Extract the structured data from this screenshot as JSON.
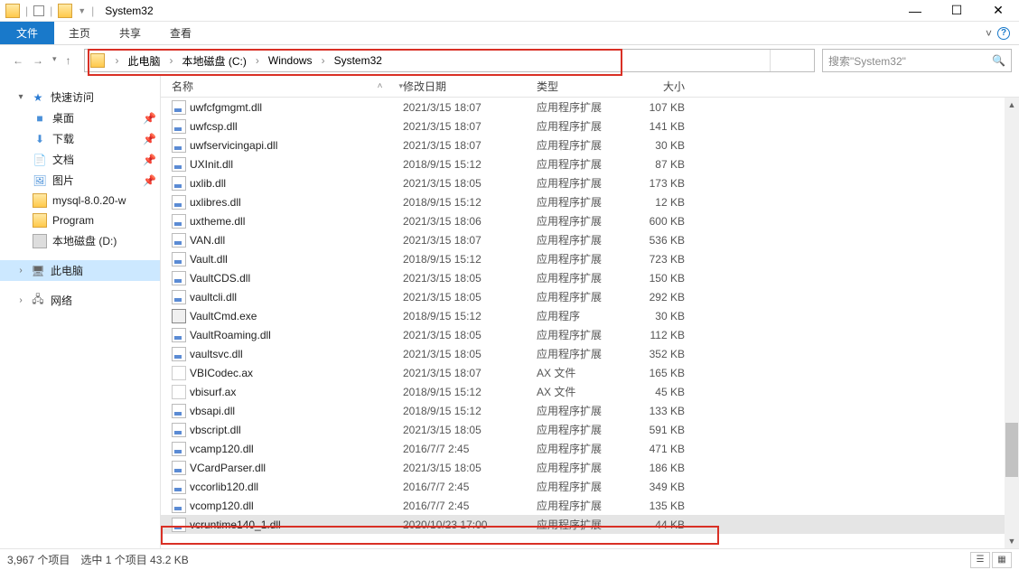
{
  "window": {
    "title": "System32"
  },
  "ribbon": {
    "file": "文件",
    "tabs": [
      "主页",
      "共享",
      "查看"
    ]
  },
  "breadcrumbs": [
    "此电脑",
    "本地磁盘 (C:)",
    "Windows",
    "System32"
  ],
  "search": {
    "placeholder": "搜索\"System32\""
  },
  "navpane": {
    "quick": {
      "label": "快速访问",
      "items": [
        {
          "label": "桌面",
          "pin": true,
          "icon": "desktop"
        },
        {
          "label": "下载",
          "pin": true,
          "icon": "download"
        },
        {
          "label": "文档",
          "pin": true,
          "icon": "doc"
        },
        {
          "label": "图片",
          "pin": true,
          "icon": "pic"
        },
        {
          "label": "mysql-8.0.20-w",
          "pin": false,
          "icon": "folder"
        },
        {
          "label": "Program",
          "pin": false,
          "icon": "folder"
        },
        {
          "label": "本地磁盘 (D:)",
          "pin": false,
          "icon": "drive"
        }
      ]
    },
    "thispc": {
      "label": "此电脑"
    },
    "network": {
      "label": "网络"
    }
  },
  "columns": {
    "name": "名称",
    "date": "修改日期",
    "type": "类型",
    "size": "大小"
  },
  "type_labels": {
    "dll": "应用程序扩展",
    "exe": "应用程序",
    "ax": "AX 文件"
  },
  "files": [
    {
      "name": "uwfcfgmgmt.dll",
      "date": "2021/3/15 18:07",
      "type": "dll",
      "size": "107 KB"
    },
    {
      "name": "uwfcsp.dll",
      "date": "2021/3/15 18:07",
      "type": "dll",
      "size": "141 KB"
    },
    {
      "name": "uwfservicingapi.dll",
      "date": "2021/3/15 18:07",
      "type": "dll",
      "size": "30 KB"
    },
    {
      "name": "UXInit.dll",
      "date": "2018/9/15 15:12",
      "type": "dll",
      "size": "87 KB"
    },
    {
      "name": "uxlib.dll",
      "date": "2021/3/15 18:05",
      "type": "dll",
      "size": "173 KB"
    },
    {
      "name": "uxlibres.dll",
      "date": "2018/9/15 15:12",
      "type": "dll",
      "size": "12 KB"
    },
    {
      "name": "uxtheme.dll",
      "date": "2021/3/15 18:06",
      "type": "dll",
      "size": "600 KB"
    },
    {
      "name": "VAN.dll",
      "date": "2021/3/15 18:07",
      "type": "dll",
      "size": "536 KB"
    },
    {
      "name": "Vault.dll",
      "date": "2018/9/15 15:12",
      "type": "dll",
      "size": "723 KB"
    },
    {
      "name": "VaultCDS.dll",
      "date": "2021/3/15 18:05",
      "type": "dll",
      "size": "150 KB"
    },
    {
      "name": "vaultcli.dll",
      "date": "2021/3/15 18:05",
      "type": "dll",
      "size": "292 KB"
    },
    {
      "name": "VaultCmd.exe",
      "date": "2018/9/15 15:12",
      "type": "exe",
      "size": "30 KB"
    },
    {
      "name": "VaultRoaming.dll",
      "date": "2021/3/15 18:05",
      "type": "dll",
      "size": "112 KB"
    },
    {
      "name": "vaultsvc.dll",
      "date": "2021/3/15 18:05",
      "type": "dll",
      "size": "352 KB"
    },
    {
      "name": "VBICodec.ax",
      "date": "2021/3/15 18:07",
      "type": "ax",
      "size": "165 KB"
    },
    {
      "name": "vbisurf.ax",
      "date": "2018/9/15 15:12",
      "type": "ax",
      "size": "45 KB"
    },
    {
      "name": "vbsapi.dll",
      "date": "2018/9/15 15:12",
      "type": "dll",
      "size": "133 KB"
    },
    {
      "name": "vbscript.dll",
      "date": "2021/3/15 18:05",
      "type": "dll",
      "size": "591 KB"
    },
    {
      "name": "vcamp120.dll",
      "date": "2016/7/7 2:45",
      "type": "dll",
      "size": "471 KB"
    },
    {
      "name": "VCardParser.dll",
      "date": "2021/3/15 18:05",
      "type": "dll",
      "size": "186 KB"
    },
    {
      "name": "vccorlib120.dll",
      "date": "2016/7/7 2:45",
      "type": "dll",
      "size": "349 KB"
    },
    {
      "name": "vcomp120.dll",
      "date": "2016/7/7 2:45",
      "type": "dll",
      "size": "135 KB"
    },
    {
      "name": "vcruntime140_1.dll",
      "date": "2020/10/23 17:00",
      "type": "dll",
      "size": "44 KB",
      "selected": true
    }
  ],
  "status": {
    "items": "3,967 个项目",
    "selected": "选中 1 个项目  43.2 KB"
  }
}
